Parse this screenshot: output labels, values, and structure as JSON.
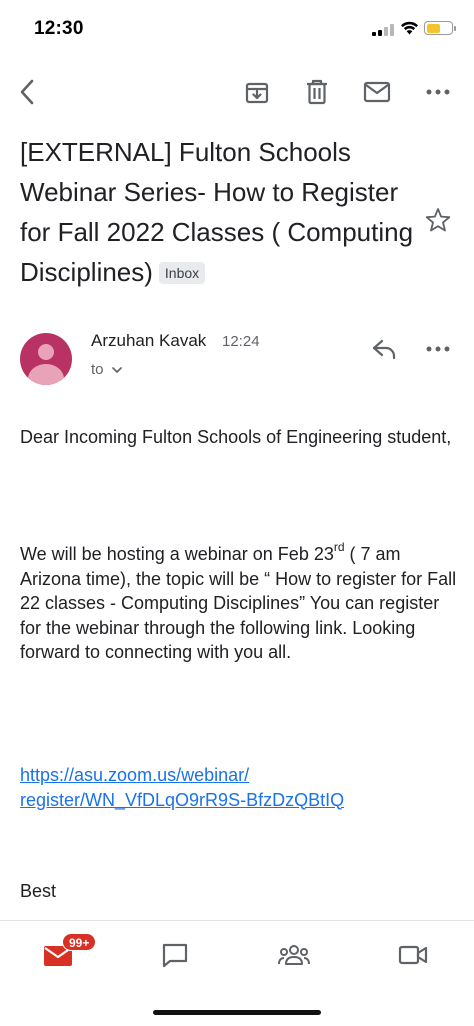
{
  "status_bar": {
    "time": "12:30",
    "battery_level": 0.55,
    "battery_color": "#f4c430"
  },
  "toolbar": {
    "back_icon": "chevron-left-icon",
    "archive_icon": "archive-icon",
    "delete_icon": "trash-icon",
    "mark_unread_icon": "mail-icon",
    "more_icon": "more-horizontal-icon"
  },
  "email": {
    "subject": "[EXTERNAL] Fulton Schools Webinar Series- How to Register for Fall 2022 Classes ( Computing Disciplines)",
    "label": "Inbox",
    "starred": false,
    "sender": {
      "name": "Arzuhan Kavak",
      "time": "12:24",
      "to_label": "to",
      "avatar_color": "#b83264"
    },
    "body": {
      "greeting": "Dear Incoming Fulton Schools of Engineering student,",
      "para_before_sup": "We will be hosting a webinar on Feb 23",
      "sup": "rd",
      "para_after_sup": "  ( 7 am Arizona time), the topic will be  “ How to register for Fall 22 classes - Computing Disciplines”  You can register for the webinar through the following link. Looking forward to connecting with you all.",
      "link": "https://asu.zoom.us/webinar/register/WN_VfDLqO9rR9S-BfzDzQBtIQ",
      "sign_off": "Best"
    }
  },
  "bottom_nav": {
    "mail_badge": "99+",
    "badge_color": "#d93025",
    "accent_color": "#d93025",
    "items": [
      "mail-icon",
      "chat-icon",
      "spaces-icon",
      "meet-icon"
    ]
  }
}
